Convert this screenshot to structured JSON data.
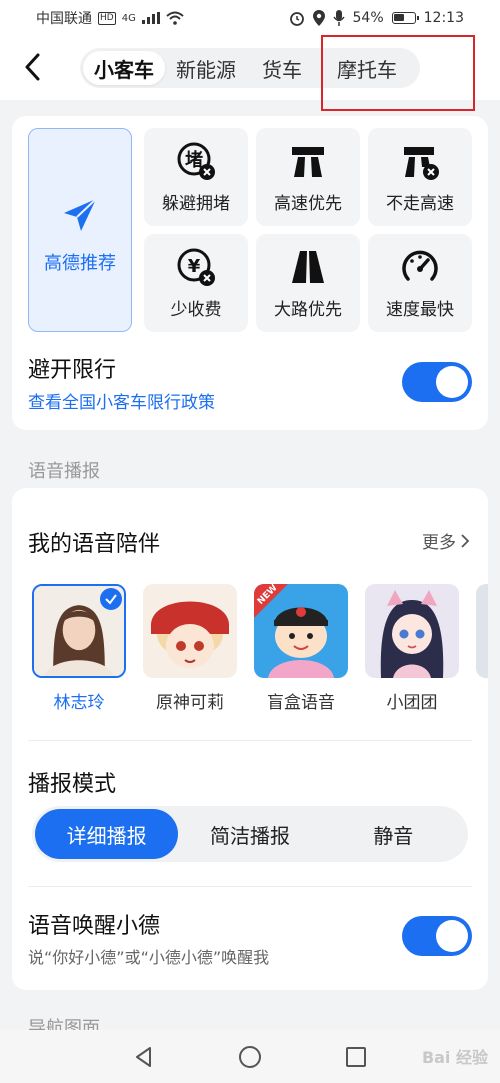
{
  "status_bar": {
    "carrier": "中国联通",
    "hd": "HD",
    "network": "4G",
    "battery": "54%",
    "battery_level": 0.54,
    "time": "12:13"
  },
  "header": {
    "tabs": [
      {
        "label": "小客车",
        "active": true
      },
      {
        "label": "新能源",
        "active": false
      },
      {
        "label": "货车",
        "active": false
      },
      {
        "label": "摩托车",
        "active": false
      }
    ],
    "highlight_color": "#d9262a"
  },
  "route_preferences": {
    "recommended": "高德推荐",
    "options": [
      {
        "label": "躲避拥堵",
        "icon": "avoid-congestion-icon"
      },
      {
        "label": "高速优先",
        "icon": "highway-priority-icon"
      },
      {
        "label": "不走高速",
        "icon": "no-highway-icon"
      },
      {
        "label": "少收费",
        "icon": "less-toll-icon"
      },
      {
        "label": "大路优先",
        "icon": "main-road-icon"
      },
      {
        "label": "速度最快",
        "icon": "fastest-speed-icon"
      }
    ],
    "restriction_title": "避开限行",
    "restriction_link": "查看全国小客车限行政策",
    "restriction_enabled": true
  },
  "voice_section": {
    "section_title": "语音播报",
    "companion_title": "我的语音陪伴",
    "more_label": "更多",
    "voices": [
      {
        "name": "林志玲",
        "selected": true
      },
      {
        "name": "原神可莉",
        "selected": false
      },
      {
        "name": "盲盒语音",
        "selected": false,
        "badge": "NEW"
      },
      {
        "name": "小团团",
        "selected": false
      }
    ],
    "mode_title": "播报模式",
    "modes": [
      {
        "label": "详细播报",
        "active": true
      },
      {
        "label": "简洁播报",
        "active": false
      },
      {
        "label": "静音",
        "active": false
      }
    ],
    "wake_title": "语音唤醒小德",
    "wake_desc": "说“你好小德”或“小德小德”唤醒我",
    "wake_enabled": true
  },
  "next_section_title": "导航图面",
  "watermark": "Bai 经验",
  "colors": {
    "accent": "#1b6ff0"
  }
}
